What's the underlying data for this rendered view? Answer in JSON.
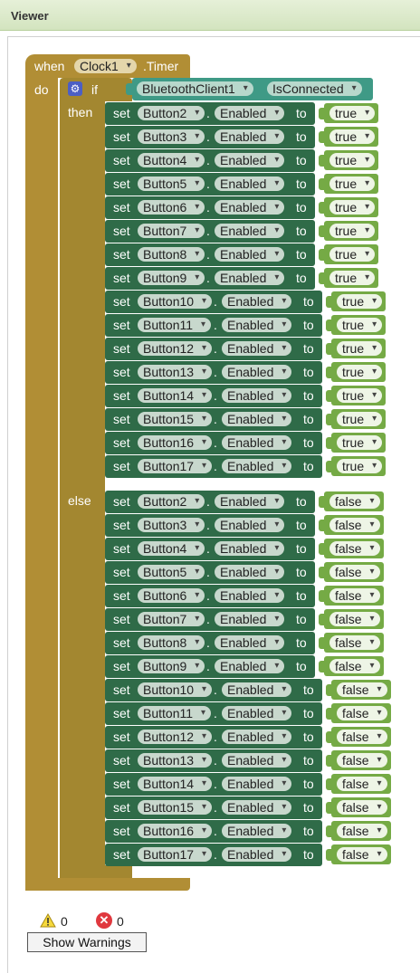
{
  "viewer": {
    "title": "Viewer"
  },
  "event": {
    "when_label": "when",
    "component": "Clock1",
    "event_name": ".Timer",
    "do_label": "do"
  },
  "if_block": {
    "if_label": "if",
    "then_label": "then",
    "else_label": "else",
    "condition": {
      "component": "BluetoothClient1",
      "dot": ".",
      "property": "IsConnected"
    }
  },
  "set_labels": {
    "set": "set",
    "dot": ".",
    "to": "to",
    "property": "Enabled"
  },
  "then_items": [
    {
      "button": "Button2",
      "value": "true"
    },
    {
      "button": "Button3",
      "value": "true"
    },
    {
      "button": "Button4",
      "value": "true"
    },
    {
      "button": "Button5",
      "value": "true"
    },
    {
      "button": "Button6",
      "value": "true"
    },
    {
      "button": "Button7",
      "value": "true"
    },
    {
      "button": "Button8",
      "value": "true"
    },
    {
      "button": "Button9",
      "value": "true"
    },
    {
      "button": "Button10",
      "value": "true"
    },
    {
      "button": "Button11",
      "value": "true"
    },
    {
      "button": "Button12",
      "value": "true"
    },
    {
      "button": "Button13",
      "value": "true"
    },
    {
      "button": "Button14",
      "value": "true"
    },
    {
      "button": "Button15",
      "value": "true"
    },
    {
      "button": "Button16",
      "value": "true"
    },
    {
      "button": "Button17",
      "value": "true"
    }
  ],
  "else_items": [
    {
      "button": "Button2",
      "value": "false"
    },
    {
      "button": "Button3",
      "value": "false"
    },
    {
      "button": "Button4",
      "value": "false"
    },
    {
      "button": "Button5",
      "value": "false"
    },
    {
      "button": "Button6",
      "value": "false"
    },
    {
      "button": "Button7",
      "value": "false"
    },
    {
      "button": "Button8",
      "value": "false"
    },
    {
      "button": "Button9",
      "value": "false"
    },
    {
      "button": "Button10",
      "value": "false"
    },
    {
      "button": "Button11",
      "value": "false"
    },
    {
      "button": "Button12",
      "value": "false"
    },
    {
      "button": "Button13",
      "value": "false"
    },
    {
      "button": "Button14",
      "value": "false"
    },
    {
      "button": "Button15",
      "value": "false"
    },
    {
      "button": "Button16",
      "value": "false"
    },
    {
      "button": "Button17",
      "value": "false"
    }
  ],
  "warnings": {
    "warning_count": "0",
    "error_count": "0",
    "show_button": "Show Warnings",
    "warning_icon": "warning-triangle-icon",
    "error_icon": "error-x-icon"
  },
  "colors": {
    "event_block": "#b18e35",
    "control_block": "#a38730",
    "setter_block": "#2f6b48",
    "getter_block": "#3f9a86",
    "boolean_block": "#75aa45",
    "mutator_gear": "#4c5fc4"
  }
}
